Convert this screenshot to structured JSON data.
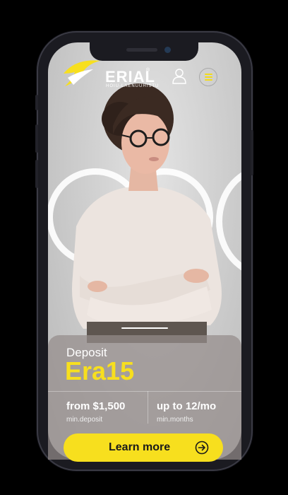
{
  "header": {
    "brand": "ERIAL",
    "brand_mark": "®",
    "brand_sub": "HOIU-LAENUÜHISTU",
    "icons": {
      "logo": "bird-logo-icon",
      "user": "user-icon",
      "menu": "hamburger-menu-icon"
    }
  },
  "hero": {
    "slider_position": 1
  },
  "card": {
    "label": "Deposit",
    "product": "Era15",
    "stats": [
      {
        "value": "from $1,500",
        "label": "min.deposit"
      },
      {
        "value": "up to 12/mo",
        "label": "min.months"
      }
    ],
    "cta": "Learn more"
  },
  "colors": {
    "accent": "#f7df1e",
    "frame": "#1b1b21",
    "background": "#000000"
  }
}
